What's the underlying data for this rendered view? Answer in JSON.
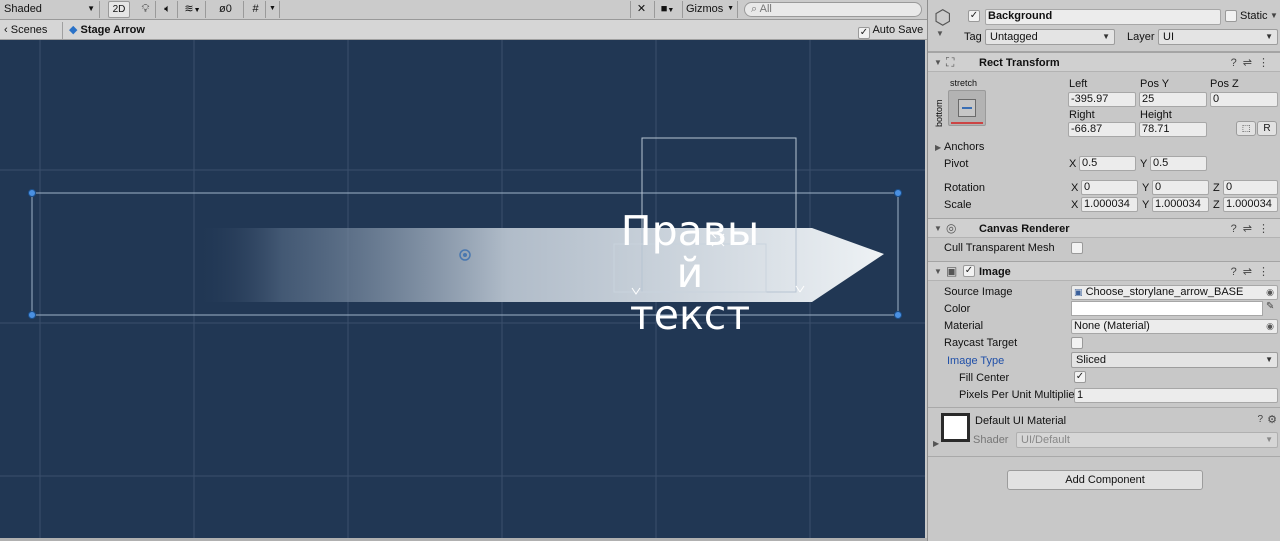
{
  "scene_toolbar": {
    "shading_mode": "Shaded",
    "mode_2d": "2D",
    "hidden_count": "0",
    "gizmos_label": "Gizmos",
    "search_placeholder": "All"
  },
  "scene_subbar": {
    "scenes_label": "Scenes",
    "stage_label": "Stage Arrow",
    "auto_save_label": "Auto Save"
  },
  "scene_view": {
    "text_line1": "Правы",
    "text_line2": "й текст",
    "background_color": "#213754"
  },
  "inspector": {
    "object": {
      "name": "Background",
      "static_label": "Static",
      "tag_label": "Tag",
      "tag_value": "Untagged",
      "layer_label": "Layer",
      "layer_value": "UI"
    },
    "rect_transform": {
      "title": "Rect Transform",
      "anchor_preset_top": "stretch",
      "anchor_preset_side": "bottom",
      "left_label": "Left",
      "left_value": "-395.97",
      "posy_label": "Pos Y",
      "posy_value": "25",
      "posz_label": "Pos Z",
      "posz_value": "0",
      "right_label": "Right",
      "right_value": "-66.87",
      "height_label": "Height",
      "height_value": "78.71",
      "r_button": "R",
      "anchors_label": "Anchors",
      "pivot_label": "Pivot",
      "pivot_x": "0.5",
      "pivot_y": "0.5",
      "rotation_label": "Rotation",
      "rot_x": "0",
      "rot_y": "0",
      "rot_z": "0",
      "scale_label": "Scale",
      "scale_x": "1.000034",
      "scale_y": "1.000034",
      "scale_z": "1.000034",
      "axis_x": "X",
      "axis_y": "Y",
      "axis_z": "Z"
    },
    "canvas_renderer": {
      "title": "Canvas Renderer",
      "cull_label": "Cull Transparent Mesh"
    },
    "image": {
      "title": "Image",
      "source_label": "Source Image",
      "source_value": "Choose_storylane_arrow_BASE",
      "color_label": "Color",
      "material_label": "Material",
      "material_value": "None (Material)",
      "raycast_label": "Raycast Target",
      "type_label": "Image Type",
      "type_value": "Sliced",
      "fill_center_label": "Fill Center",
      "ppu_label": "Pixels Per Unit Multiplie",
      "ppu_value": "1"
    },
    "material_preview": {
      "title": "Default UI Material",
      "shader_label": "Shader",
      "shader_value": "UI/Default"
    },
    "add_component_label": "Add Component"
  }
}
